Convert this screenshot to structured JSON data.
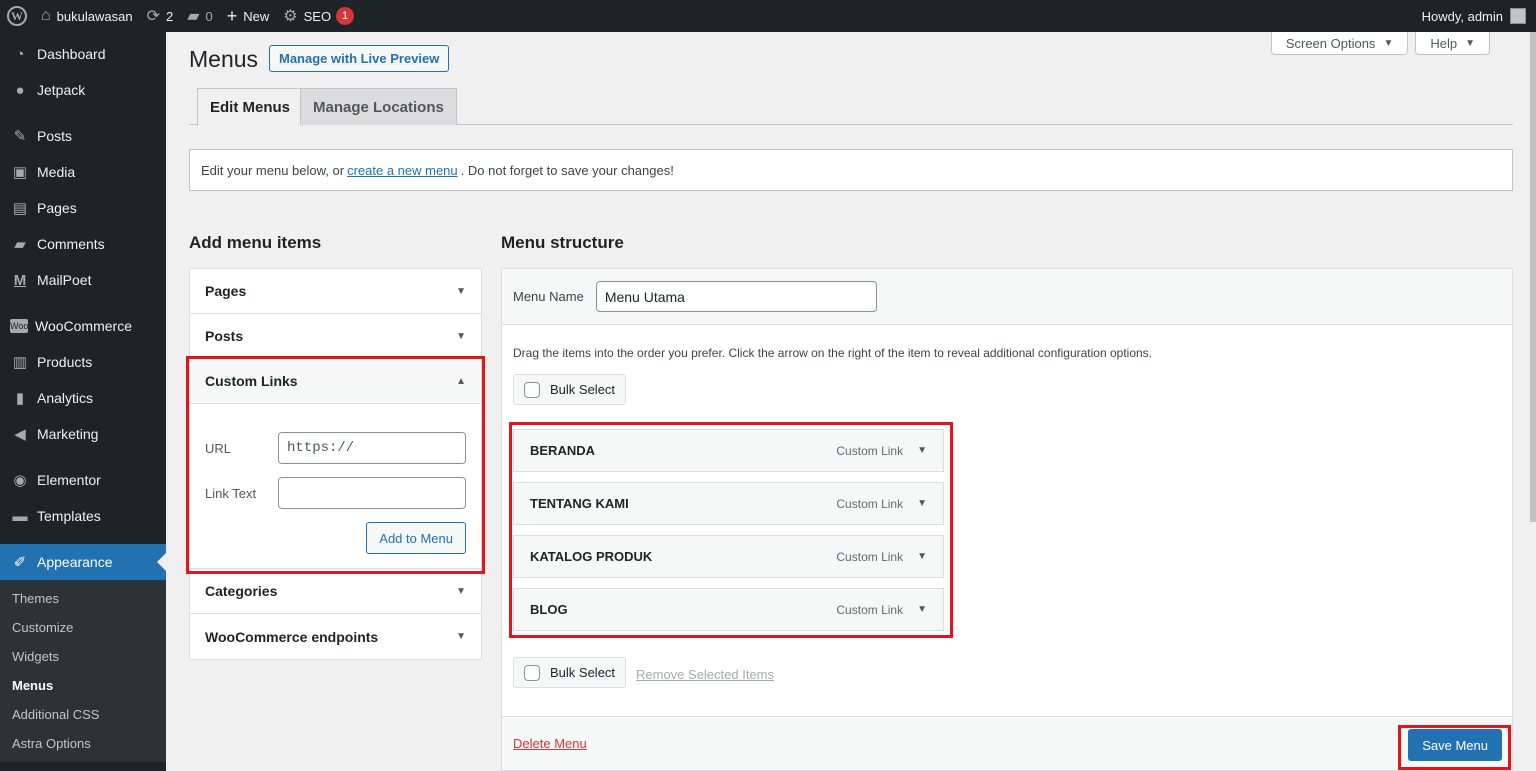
{
  "adminbar": {
    "site_name": "bukulawasan",
    "updates_count": "2",
    "comments_count": "0",
    "new_label": "New",
    "seo_label": "SEO",
    "seo_badge": "1",
    "howdy": "Howdy, admin"
  },
  "sidebar": {
    "items": [
      {
        "label": "Dashboard",
        "icon": "dashboard-icon"
      },
      {
        "label": "Jetpack",
        "icon": "jetpack-icon"
      },
      {
        "label": "Posts",
        "icon": "pin-icon"
      },
      {
        "label": "Media",
        "icon": "media-icon"
      },
      {
        "label": "Pages",
        "icon": "page-icon"
      },
      {
        "label": "Comments",
        "icon": "comment-icon"
      },
      {
        "label": "MailPoet",
        "icon": "mailpoet-icon"
      },
      {
        "label": "WooCommerce",
        "icon": "woo-icon"
      },
      {
        "label": "Products",
        "icon": "archive-icon"
      },
      {
        "label": "Analytics",
        "icon": "chart-icon"
      },
      {
        "label": "Marketing",
        "icon": "megaphone-icon"
      },
      {
        "label": "Elementor",
        "icon": "elementor-icon"
      },
      {
        "label": "Templates",
        "icon": "folder-icon"
      },
      {
        "label": "Appearance",
        "icon": "brush-icon"
      }
    ],
    "submenu": [
      "Themes",
      "Customize",
      "Widgets",
      "Menus",
      "Additional CSS",
      "Astra Options"
    ]
  },
  "header": {
    "screen_options": "Screen Options",
    "help": "Help",
    "title": "Menus",
    "live_preview": "Manage with Live Preview",
    "tabs": [
      "Edit Menus",
      "Manage Locations"
    ]
  },
  "notice": {
    "prefix": "Edit your menu below, or",
    "link": "create a new menu",
    "suffix": ". Do not forget to save your changes!"
  },
  "add_items": {
    "heading": "Add menu items",
    "sections": [
      "Pages",
      "Posts",
      "Custom Links",
      "Categories",
      "WooCommerce endpoints"
    ],
    "url_label": "URL",
    "url_value": "https://",
    "link_text_label": "Link Text",
    "add_button": "Add to Menu"
  },
  "structure": {
    "heading": "Menu structure",
    "menu_name_label": "Menu Name",
    "menu_name_value": "Menu Utama",
    "hint": "Drag the items into the order you prefer. Click the arrow on the right of the item to reveal additional configuration options.",
    "bulk_select": "Bulk Select",
    "items": [
      {
        "title": "BERANDA",
        "type": "Custom Link"
      },
      {
        "title": "TENTANG KAMI",
        "type": "Custom Link"
      },
      {
        "title": "KATALOG PRODUK",
        "type": "Custom Link"
      },
      {
        "title": "BLOG",
        "type": "Custom Link"
      }
    ],
    "remove_selected": "Remove Selected Items",
    "delete_menu": "Delete Menu",
    "save_menu": "Save Menu"
  },
  "colors": {
    "accent": "#2271b1",
    "highlight": "#e2151e",
    "admin_bar": "#1d2327"
  }
}
